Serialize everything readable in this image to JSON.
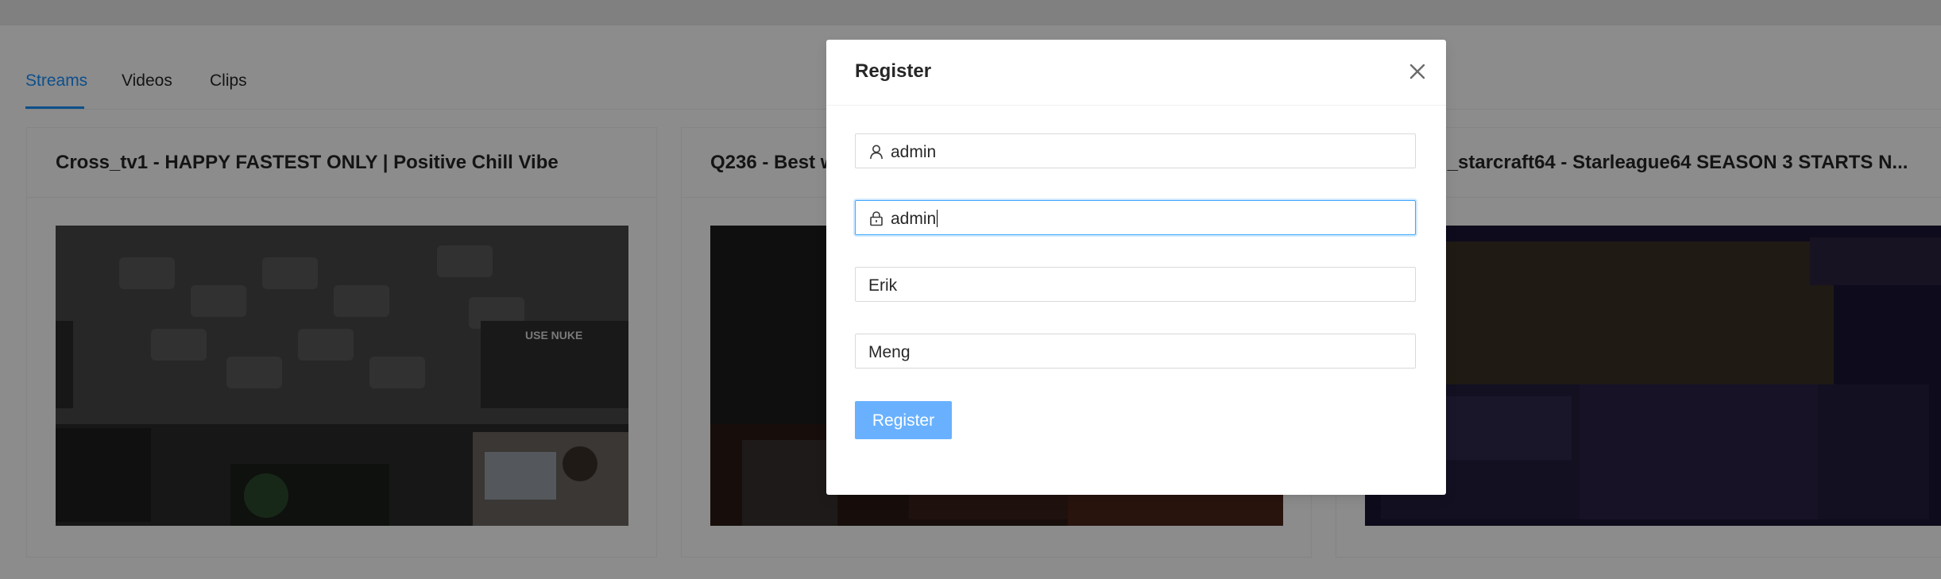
{
  "tabs": [
    {
      "label": "Streams",
      "active": true
    },
    {
      "label": "Videos",
      "active": false
    },
    {
      "label": "Clips",
      "active": false
    }
  ],
  "cards": [
    {
      "title": "Cross_tv1 - HAPPY FASTEST ONLY | Positive Chill Vibe",
      "thumbnail_overlay_text": "USE NUKE"
    },
    {
      "title": "Q236 - Best w"
    },
    {
      "title": "nal_starcraft64 - Starleague64 SEASON 3 STARTS N..."
    }
  ],
  "modal": {
    "title": "Register",
    "close_icon": "close-icon",
    "fields": [
      {
        "icon": "user-icon",
        "value": "admin"
      },
      {
        "icon": "lock-icon",
        "value": "admin",
        "focused": true
      },
      {
        "value": "Erik"
      },
      {
        "value": "Meng"
      }
    ],
    "submit_label": "Register"
  },
  "colors": {
    "accent": "#1890ff",
    "button": "#69b1ff"
  }
}
